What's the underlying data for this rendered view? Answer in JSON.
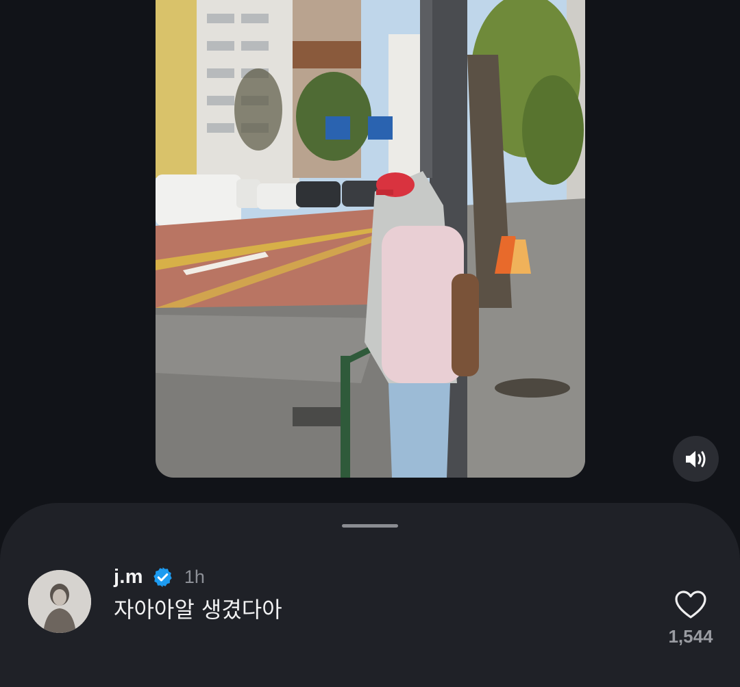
{
  "post": {
    "photo_icon": "street-photo",
    "volume_icon": "volume-icon"
  },
  "comment": {
    "username": "j.m",
    "verified_icon": "verified-badge-icon",
    "time": "1h",
    "text": "자아아알 생겼다아",
    "like_icon": "heart-outline-icon",
    "like_count": "1,544"
  },
  "colors": {
    "background": "#111318",
    "sheet": "#1f2127",
    "verified_blue": "#1d9bf0",
    "muted_text": "#8d9097"
  }
}
